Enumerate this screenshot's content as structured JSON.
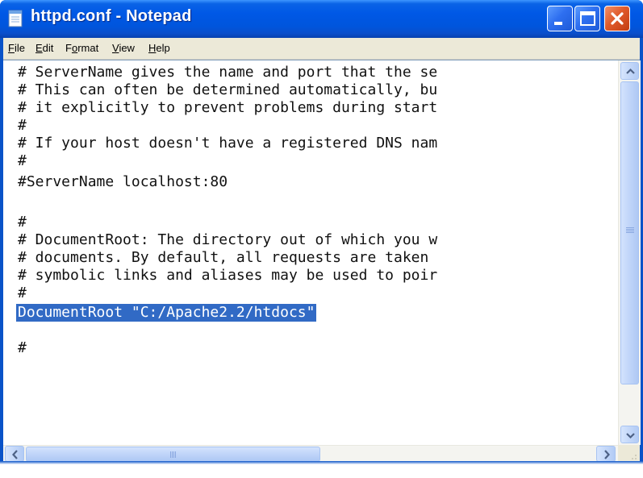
{
  "window": {
    "title": "httpd.conf - Notepad"
  },
  "menu": {
    "file": "File",
    "edit": "Edit",
    "format": "Format",
    "view": "View",
    "help": "Help"
  },
  "editor": {
    "lines": [
      "# ServerName gives the name and port that the se",
      "# This can often be determined automatically, bu",
      "# it explicitly to prevent problems during start",
      "#",
      "# If your host doesn't have a registered DNS nam",
      "#",
      "#ServerName localhost:80",
      "",
      "#",
      "# DocumentRoot: The directory out of which you w",
      "# documents. By default, all requests are taken",
      "# symbolic links and aliases may be used to poir",
      "#",
      "DocumentRoot \"C:/Apache2.2/htdocs\"",
      "",
      "#"
    ],
    "selected_line_index": 13
  },
  "icons": {
    "app": "notepad-icon",
    "minimize": "minimize-icon",
    "maximize": "maximize-icon",
    "close": "close-icon",
    "scroll_up": "arrow-up-icon",
    "scroll_down": "arrow-down-icon",
    "scroll_left": "arrow-left-icon",
    "scroll_right": "arrow-right-icon"
  },
  "colors": {
    "selection": "#316ac5",
    "titlebar": "#0058e6",
    "close_button": "#e05a2a"
  }
}
